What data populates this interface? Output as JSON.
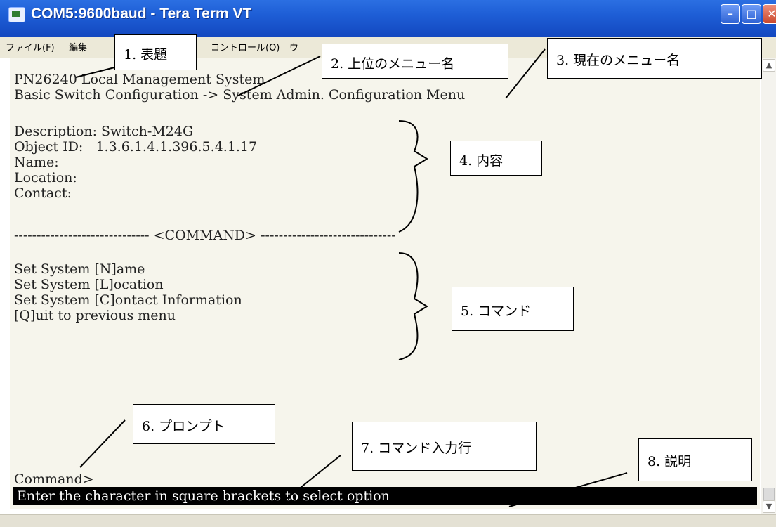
{
  "window": {
    "title": "COM5:9600baud - Tera Term VT",
    "buttons": {
      "minimize": "–",
      "maximize": "□",
      "close": "✕"
    }
  },
  "menubar": {
    "items": [
      "ファイル(F)",
      "編集",
      "コントロール(O)",
      "ウ"
    ]
  },
  "terminal": {
    "header_line1": "PN26240 Local Management System",
    "header_line2": "Basic Switch Configuration -> System Admin. Configuration Menu",
    "content": [
      "Description: Switch-M24G",
      "Object ID:   1.3.6.1.4.1.396.5.4.1.17",
      "Name:",
      "Location:",
      "Contact:"
    ],
    "separator": "------------------------------ <COMMAND> ------------------------------",
    "commands": [
      "Set System [N]ame",
      "Set System [L]ocation",
      "Set System [C]ontact Information",
      "[Q]uit to previous menu"
    ],
    "prompt": "Command>",
    "status": "Enter the character in square brackets to select option"
  },
  "annotations": [
    {
      "id": "title",
      "label": "1. 表題"
    },
    {
      "id": "parent-menu",
      "label": "2. 上位のメニュー名"
    },
    {
      "id": "current-menu",
      "label": "3. 現在のメニュー名"
    },
    {
      "id": "content",
      "label": "4. 内容"
    },
    {
      "id": "command",
      "label": "5. コマンド"
    },
    {
      "id": "prompt",
      "label": "6. プロンプト"
    },
    {
      "id": "command-input",
      "label": "7. コマンド入力行"
    },
    {
      "id": "description",
      "label": "8. 説明"
    }
  ],
  "colors": {
    "titlebar": "#1e5ed6",
    "terminal_bg": "#f6f5ec",
    "terminal_text": "#222222",
    "status_bg": "#000000",
    "status_text": "#ffffff"
  },
  "icons": [
    "tera-term-app-icon",
    "minimize-icon",
    "maximize-icon",
    "close-icon",
    "scroll-up-icon",
    "scroll-down-icon"
  ]
}
